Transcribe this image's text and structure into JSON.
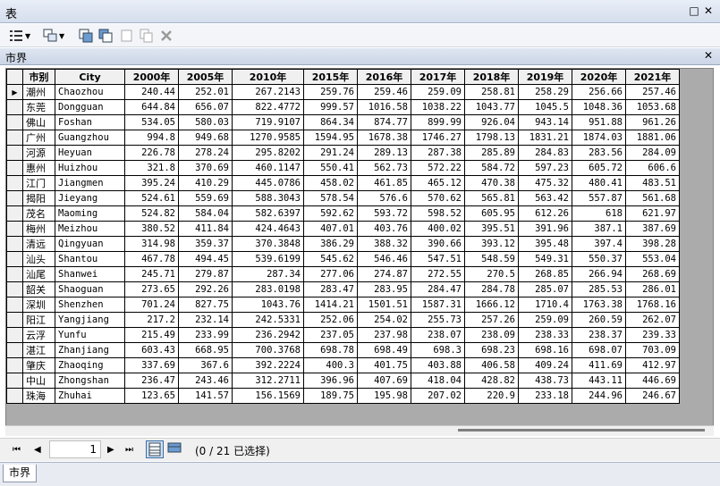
{
  "window": {
    "title": "表",
    "close_glyph": "✕",
    "restore_glyph": "□"
  },
  "table_tab": {
    "title": "市界",
    "close_glyph": "✕"
  },
  "columns": [
    "市别",
    "City",
    "2000年",
    "2005年",
    "2010年",
    "2015年",
    "2016年",
    "2017年",
    "2018年",
    "2019年",
    "2020年",
    "2021年"
  ],
  "rows": [
    [
      "潮州",
      "Chaozhou",
      "240.44",
      "252.01",
      "267.2143",
      "259.76",
      "259.46",
      "259.09",
      "258.81",
      "258.29",
      "256.66",
      "257.46"
    ],
    [
      "东莞",
      "Dongguan",
      "644.84",
      "656.07",
      "822.4772",
      "999.57",
      "1016.58",
      "1038.22",
      "1043.77",
      "1045.5",
      "1048.36",
      "1053.68"
    ],
    [
      "佛山",
      "Foshan",
      "534.05",
      "580.03",
      "719.9107",
      "864.34",
      "874.77",
      "899.99",
      "926.04",
      "943.14",
      "951.88",
      "961.26"
    ],
    [
      "广州",
      "Guangzhou",
      "994.8",
      "949.68",
      "1270.9585",
      "1594.95",
      "1678.38",
      "1746.27",
      "1798.13",
      "1831.21",
      "1874.03",
      "1881.06"
    ],
    [
      "河源",
      "Heyuan",
      "226.78",
      "278.24",
      "295.8202",
      "291.24",
      "289.13",
      "287.38",
      "285.89",
      "284.83",
      "283.56",
      "284.09"
    ],
    [
      "惠州",
      "Huizhou",
      "321.8",
      "370.69",
      "460.1147",
      "550.41",
      "562.73",
      "572.22",
      "584.72",
      "597.23",
      "605.72",
      "606.6"
    ],
    [
      "江门",
      "Jiangmen",
      "395.24",
      "410.29",
      "445.0786",
      "458.02",
      "461.85",
      "465.12",
      "470.38",
      "475.32",
      "480.41",
      "483.51"
    ],
    [
      "揭阳",
      "Jieyang",
      "524.61",
      "559.69",
      "588.3043",
      "578.54",
      "576.6",
      "570.62",
      "565.81",
      "563.42",
      "557.87",
      "561.68"
    ],
    [
      "茂名",
      "Maoming",
      "524.82",
      "584.04",
      "582.6397",
      "592.62",
      "593.72",
      "598.52",
      "605.95",
      "612.26",
      "618",
      "621.97"
    ],
    [
      "梅州",
      "Meizhou",
      "380.52",
      "411.84",
      "424.4643",
      "407.01",
      "403.76",
      "400.02",
      "395.51",
      "391.96",
      "387.1",
      "387.69"
    ],
    [
      "清远",
      "Qingyuan",
      "314.98",
      "359.37",
      "370.3848",
      "386.29",
      "388.32",
      "390.66",
      "393.12",
      "395.48",
      "397.4",
      "398.28"
    ],
    [
      "汕头",
      "Shantou",
      "467.78",
      "494.45",
      "539.6199",
      "545.62",
      "546.46",
      "547.51",
      "548.59",
      "549.31",
      "550.37",
      "553.04"
    ],
    [
      "汕尾",
      "Shanwei",
      "245.71",
      "279.87",
      "287.34",
      "277.06",
      "274.87",
      "272.55",
      "270.5",
      "268.85",
      "266.94",
      "268.69"
    ],
    [
      "韶关",
      "Shaoguan",
      "273.65",
      "292.26",
      "283.0198",
      "283.47",
      "283.95",
      "284.47",
      "284.78",
      "285.07",
      "285.53",
      "286.01"
    ],
    [
      "深圳",
      "Shenzhen",
      "701.24",
      "827.75",
      "1043.76",
      "1414.21",
      "1501.51",
      "1587.31",
      "1666.12",
      "1710.4",
      "1763.38",
      "1768.16"
    ],
    [
      "阳江",
      "Yangjiang",
      "217.2",
      "232.14",
      "242.5331",
      "252.06",
      "254.02",
      "255.73",
      "257.26",
      "259.09",
      "260.59",
      "262.07"
    ],
    [
      "云浮",
      "Yunfu",
      "215.49",
      "233.99",
      "236.2942",
      "237.05",
      "237.98",
      "238.07",
      "238.09",
      "238.33",
      "238.37",
      "239.33"
    ],
    [
      "湛江",
      "Zhanjiang",
      "603.43",
      "668.95",
      "700.3768",
      "698.78",
      "698.49",
      "698.3",
      "698.23",
      "698.16",
      "698.07",
      "703.09"
    ],
    [
      "肇庆",
      "Zhaoqing",
      "337.69",
      "367.6",
      "392.2224",
      "400.3",
      "401.75",
      "403.88",
      "406.58",
      "409.24",
      "411.69",
      "412.97"
    ],
    [
      "中山",
      "Zhongshan",
      "236.47",
      "243.46",
      "312.2711",
      "396.96",
      "407.69",
      "418.04",
      "428.82",
      "438.73",
      "443.11",
      "446.69"
    ],
    [
      "珠海",
      "Zhuhai",
      "123.65",
      "141.57",
      "156.1569",
      "189.75",
      "195.98",
      "207.02",
      "220.9",
      "233.18",
      "244.96",
      "246.67"
    ]
  ],
  "current_row_marker": "▶",
  "navigator": {
    "first": "⏮",
    "prev": "◀",
    "next": "▶",
    "last": "⏭",
    "page": "1",
    "status": "(0 / 21 已选择)"
  },
  "bottom_tab": {
    "label": "市界"
  },
  "colors": {
    "titlebar": "#d5deed",
    "grid_bg": "#ababab",
    "accent": "#3a6ea5"
  }
}
